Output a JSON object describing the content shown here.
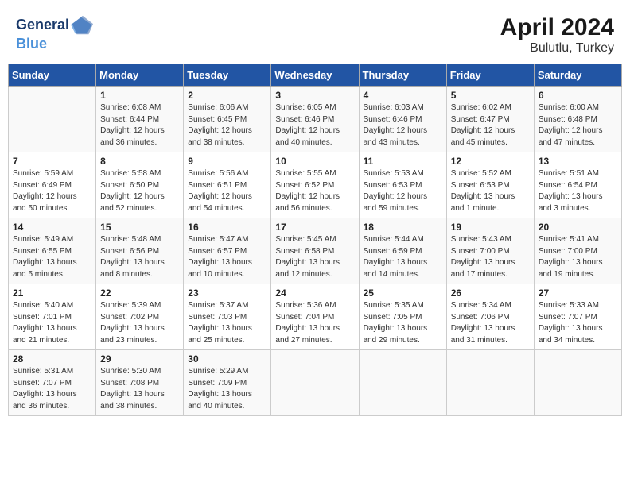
{
  "header": {
    "logo_line1": "General",
    "logo_line2": "Blue",
    "title": "April 2024",
    "subtitle": "Bulutlu, Turkey"
  },
  "columns": [
    "Sunday",
    "Monday",
    "Tuesday",
    "Wednesday",
    "Thursday",
    "Friday",
    "Saturday"
  ],
  "weeks": [
    [
      {
        "day": "",
        "lines": []
      },
      {
        "day": "1",
        "lines": [
          "Sunrise: 6:08 AM",
          "Sunset: 6:44 PM",
          "Daylight: 12 hours",
          "and 36 minutes."
        ]
      },
      {
        "day": "2",
        "lines": [
          "Sunrise: 6:06 AM",
          "Sunset: 6:45 PM",
          "Daylight: 12 hours",
          "and 38 minutes."
        ]
      },
      {
        "day": "3",
        "lines": [
          "Sunrise: 6:05 AM",
          "Sunset: 6:46 PM",
          "Daylight: 12 hours",
          "and 40 minutes."
        ]
      },
      {
        "day": "4",
        "lines": [
          "Sunrise: 6:03 AM",
          "Sunset: 6:46 PM",
          "Daylight: 12 hours",
          "and 43 minutes."
        ]
      },
      {
        "day": "5",
        "lines": [
          "Sunrise: 6:02 AM",
          "Sunset: 6:47 PM",
          "Daylight: 12 hours",
          "and 45 minutes."
        ]
      },
      {
        "day": "6",
        "lines": [
          "Sunrise: 6:00 AM",
          "Sunset: 6:48 PM",
          "Daylight: 12 hours",
          "and 47 minutes."
        ]
      }
    ],
    [
      {
        "day": "7",
        "lines": [
          "Sunrise: 5:59 AM",
          "Sunset: 6:49 PM",
          "Daylight: 12 hours",
          "and 50 minutes."
        ]
      },
      {
        "day": "8",
        "lines": [
          "Sunrise: 5:58 AM",
          "Sunset: 6:50 PM",
          "Daylight: 12 hours",
          "and 52 minutes."
        ]
      },
      {
        "day": "9",
        "lines": [
          "Sunrise: 5:56 AM",
          "Sunset: 6:51 PM",
          "Daylight: 12 hours",
          "and 54 minutes."
        ]
      },
      {
        "day": "10",
        "lines": [
          "Sunrise: 5:55 AM",
          "Sunset: 6:52 PM",
          "Daylight: 12 hours",
          "and 56 minutes."
        ]
      },
      {
        "day": "11",
        "lines": [
          "Sunrise: 5:53 AM",
          "Sunset: 6:53 PM",
          "Daylight: 12 hours",
          "and 59 minutes."
        ]
      },
      {
        "day": "12",
        "lines": [
          "Sunrise: 5:52 AM",
          "Sunset: 6:53 PM",
          "Daylight: 13 hours",
          "and 1 minute."
        ]
      },
      {
        "day": "13",
        "lines": [
          "Sunrise: 5:51 AM",
          "Sunset: 6:54 PM",
          "Daylight: 13 hours",
          "and 3 minutes."
        ]
      }
    ],
    [
      {
        "day": "14",
        "lines": [
          "Sunrise: 5:49 AM",
          "Sunset: 6:55 PM",
          "Daylight: 13 hours",
          "and 5 minutes."
        ]
      },
      {
        "day": "15",
        "lines": [
          "Sunrise: 5:48 AM",
          "Sunset: 6:56 PM",
          "Daylight: 13 hours",
          "and 8 minutes."
        ]
      },
      {
        "day": "16",
        "lines": [
          "Sunrise: 5:47 AM",
          "Sunset: 6:57 PM",
          "Daylight: 13 hours",
          "and 10 minutes."
        ]
      },
      {
        "day": "17",
        "lines": [
          "Sunrise: 5:45 AM",
          "Sunset: 6:58 PM",
          "Daylight: 13 hours",
          "and 12 minutes."
        ]
      },
      {
        "day": "18",
        "lines": [
          "Sunrise: 5:44 AM",
          "Sunset: 6:59 PM",
          "Daylight: 13 hours",
          "and 14 minutes."
        ]
      },
      {
        "day": "19",
        "lines": [
          "Sunrise: 5:43 AM",
          "Sunset: 7:00 PM",
          "Daylight: 13 hours",
          "and 17 minutes."
        ]
      },
      {
        "day": "20",
        "lines": [
          "Sunrise: 5:41 AM",
          "Sunset: 7:00 PM",
          "Daylight: 13 hours",
          "and 19 minutes."
        ]
      }
    ],
    [
      {
        "day": "21",
        "lines": [
          "Sunrise: 5:40 AM",
          "Sunset: 7:01 PM",
          "Daylight: 13 hours",
          "and 21 minutes."
        ]
      },
      {
        "day": "22",
        "lines": [
          "Sunrise: 5:39 AM",
          "Sunset: 7:02 PM",
          "Daylight: 13 hours",
          "and 23 minutes."
        ]
      },
      {
        "day": "23",
        "lines": [
          "Sunrise: 5:37 AM",
          "Sunset: 7:03 PM",
          "Daylight: 13 hours",
          "and 25 minutes."
        ]
      },
      {
        "day": "24",
        "lines": [
          "Sunrise: 5:36 AM",
          "Sunset: 7:04 PM",
          "Daylight: 13 hours",
          "and 27 minutes."
        ]
      },
      {
        "day": "25",
        "lines": [
          "Sunrise: 5:35 AM",
          "Sunset: 7:05 PM",
          "Daylight: 13 hours",
          "and 29 minutes."
        ]
      },
      {
        "day": "26",
        "lines": [
          "Sunrise: 5:34 AM",
          "Sunset: 7:06 PM",
          "Daylight: 13 hours",
          "and 31 minutes."
        ]
      },
      {
        "day": "27",
        "lines": [
          "Sunrise: 5:33 AM",
          "Sunset: 7:07 PM",
          "Daylight: 13 hours",
          "and 34 minutes."
        ]
      }
    ],
    [
      {
        "day": "28",
        "lines": [
          "Sunrise: 5:31 AM",
          "Sunset: 7:07 PM",
          "Daylight: 13 hours",
          "and 36 minutes."
        ]
      },
      {
        "day": "29",
        "lines": [
          "Sunrise: 5:30 AM",
          "Sunset: 7:08 PM",
          "Daylight: 13 hours",
          "and 38 minutes."
        ]
      },
      {
        "day": "30",
        "lines": [
          "Sunrise: 5:29 AM",
          "Sunset: 7:09 PM",
          "Daylight: 13 hours",
          "and 40 minutes."
        ]
      },
      {
        "day": "",
        "lines": []
      },
      {
        "day": "",
        "lines": []
      },
      {
        "day": "",
        "lines": []
      },
      {
        "day": "",
        "lines": []
      }
    ]
  ]
}
